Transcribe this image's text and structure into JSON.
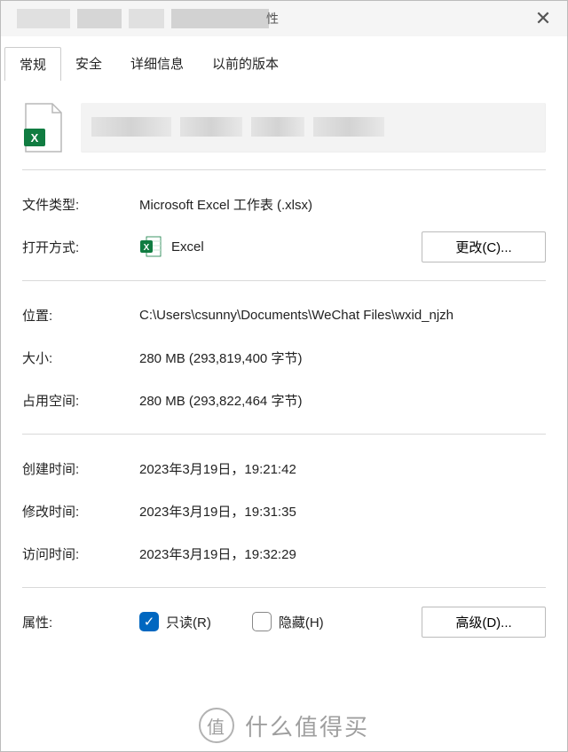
{
  "titlebar": {
    "suffix": "性"
  },
  "tabs": {
    "general": "常规",
    "security": "安全",
    "details": "详细信息",
    "previous": "以前的版本"
  },
  "labels": {
    "file_type": "文件类型:",
    "open_with": "打开方式:",
    "location": "位置:",
    "size": "大小:",
    "size_on_disk": "占用空间:",
    "created": "创建时间:",
    "modified": "修改时间:",
    "accessed": "访问时间:",
    "attributes": "属性:"
  },
  "values": {
    "file_type": "Microsoft Excel 工作表 (.xlsx)",
    "app_name": "Excel",
    "location": "C:\\Users\\csunny\\Documents\\WeChat Files\\wxid_njzh",
    "size": "280 MB (293,819,400 字节)",
    "size_on_disk": "280 MB (293,822,464 字节)",
    "created": "2023年3月19日，19:21:42",
    "modified": "2023年3月19日，19:31:35",
    "accessed": "2023年3月19日，19:32:29",
    "readonly": "只读(R)",
    "hidden": "隐藏(H)"
  },
  "buttons": {
    "change": "更改(C)...",
    "advanced": "高级(D)..."
  },
  "watermark": {
    "logo": "值",
    "text": "什么值得买"
  }
}
